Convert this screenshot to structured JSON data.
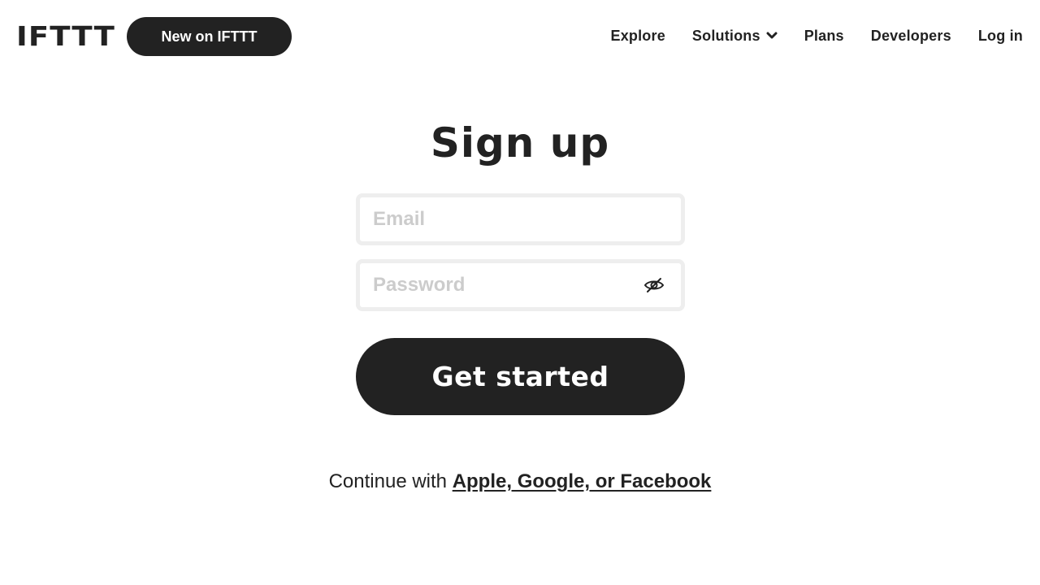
{
  "header": {
    "logo": "IFTTT",
    "new_button": "New on IFTTT",
    "nav": [
      {
        "label": "Explore"
      },
      {
        "label": "Solutions",
        "icon": "chevron-down-icon"
      },
      {
        "label": "Plans"
      },
      {
        "label": "Developers"
      },
      {
        "label": "Log in"
      }
    ]
  },
  "signup": {
    "title": "Sign up",
    "email_placeholder": "Email",
    "email_value": "",
    "password_placeholder": "Password",
    "password_value": "",
    "password_toggle_icon": "eye-slash-icon",
    "submit_label": "Get started",
    "continue_prefix": "Continue with",
    "continue_link": "Apple, Google, or Facebook"
  },
  "colors": {
    "primary": "#222222",
    "background": "#ffffff",
    "field_border": "#eeeeee",
    "placeholder": "#cccccc"
  }
}
